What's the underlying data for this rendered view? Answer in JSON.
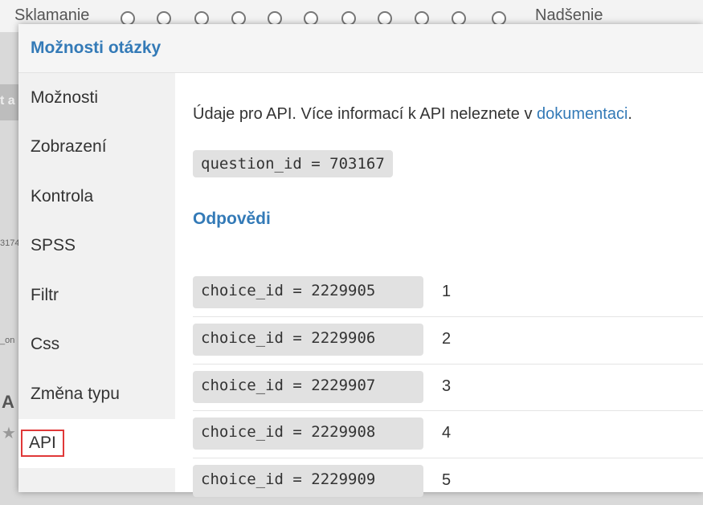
{
  "background": {
    "scale_left": "Sklamanie",
    "scale_right": "Nadšenie",
    "snippet_1": "3174",
    "snippet_2": "_on",
    "big_letter": "A",
    "star": "★",
    "gray_text": "t a"
  },
  "modal": {
    "title": "Možnosti otázky",
    "sidebar": {
      "items": [
        {
          "label": "Možnosti"
        },
        {
          "label": "Zobrazení"
        },
        {
          "label": "Kontrola"
        },
        {
          "label": "SPSS"
        },
        {
          "label": "Filtr"
        },
        {
          "label": "Css"
        },
        {
          "label": "Změna typu"
        },
        {
          "label": "API"
        }
      ],
      "active": "API"
    },
    "api": {
      "intro_text": "Údaje pro API. Více informací k API neleznete v ",
      "doc_link": "dokumentaci",
      "intro_end": ".",
      "question_id": "question_id = 703167",
      "answers_title": "Odpovědi",
      "choices": [
        {
          "code": "choice_id = 2229905",
          "label": "1"
        },
        {
          "code": "choice_id = 2229906",
          "label": "2"
        },
        {
          "code": "choice_id = 2229907",
          "label": "3"
        },
        {
          "code": "choice_id = 2229908",
          "label": "4"
        },
        {
          "code": "choice_id = 2229909",
          "label": "5"
        }
      ]
    }
  },
  "colors": {
    "accent": "#337ab7",
    "highlight_border": "#e03838"
  }
}
